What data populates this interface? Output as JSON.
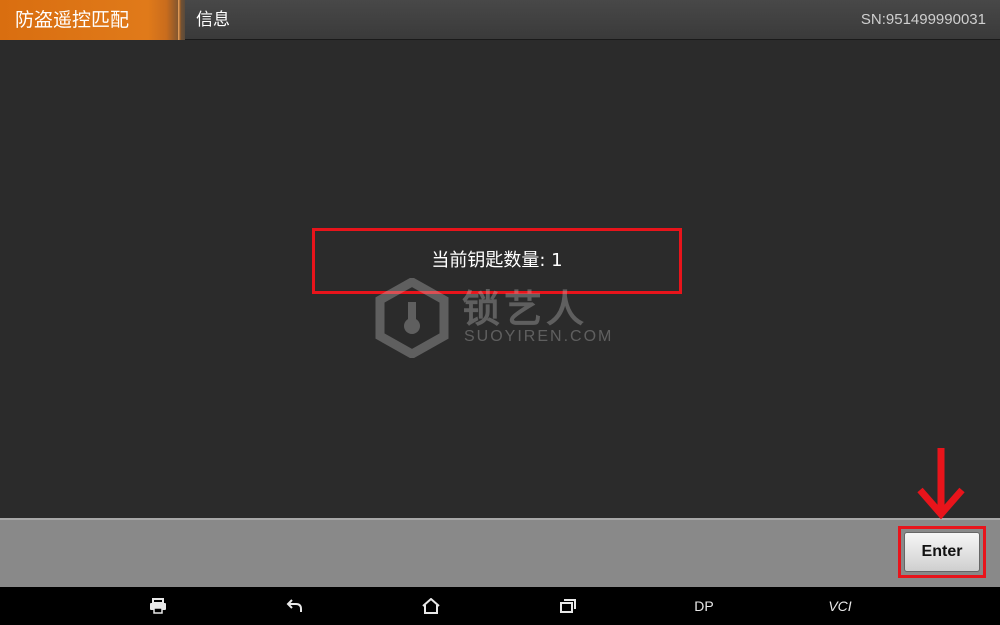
{
  "titlebar": {
    "app_title": "防盗遥控匹配",
    "page_title": "信息",
    "serial": "SN:951499990031"
  },
  "message": {
    "text": "当前钥匙数量: 1"
  },
  "watermark": {
    "brand_cn": "锁艺人",
    "brand_en": "SUOYIREN.COM"
  },
  "actions": {
    "enter_label": "Enter"
  },
  "navbar": {
    "dp_label": "DP",
    "vci_label": "VCI"
  },
  "colors": {
    "accent_orange": "#e07a1a",
    "highlight_red": "#e8141b",
    "content_bg": "#2b2b2b",
    "actionbar_bg": "#898989"
  }
}
